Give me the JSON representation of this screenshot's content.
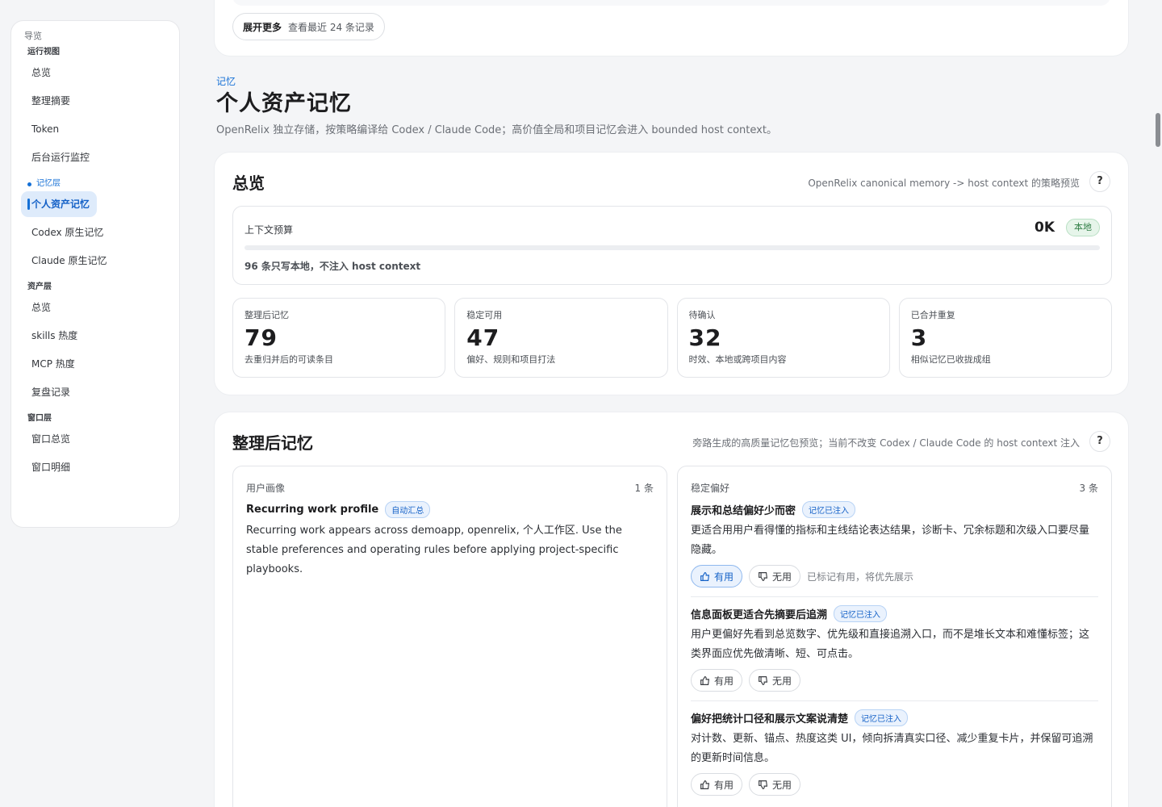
{
  "sidebar": {
    "title": "导览",
    "groups": [
      {
        "label": "运行视图",
        "items": [
          "总览",
          "整理摘要",
          "Token",
          "后台运行监控"
        ]
      },
      {
        "label": "记忆层",
        "items": [
          "个人资产记忆",
          "Codex 原生记忆",
          "Claude 原生记忆"
        ]
      },
      {
        "label": "资产层",
        "items": [
          "总览",
          "skills 热度",
          "MCP 热度",
          "复盘记录"
        ]
      },
      {
        "label": "窗口层",
        "items": [
          "窗口总览",
          "窗口明细"
        ]
      }
    ]
  },
  "top": {
    "expand_bold": "展开更多",
    "expand_sub": "查看最近 24 条记录"
  },
  "section": {
    "tag": "记忆",
    "title": "个人资产记忆",
    "desc": "OpenRelix 独立存储，按策略编译给 Codex / Claude Code；高价值全局和项目记忆会进入 bounded host context。"
  },
  "overview": {
    "title": "总览",
    "hint": "OpenRelix canonical memory -> host context 的策略预览",
    "help": "?",
    "budget": {
      "label": "上下文预算",
      "value": "0K",
      "badge": "本地",
      "fill": 0,
      "note": "96 条只写本地，不注入 host context"
    },
    "stats": [
      {
        "label": "整理后记忆",
        "value": "79",
        "sub": "去重归并后的可读条目"
      },
      {
        "label": "稳定可用",
        "value": "47",
        "sub": "偏好、规则和项目打法"
      },
      {
        "label": "待确认",
        "value": "32",
        "sub": "时效、本地或跨项目内容"
      },
      {
        "label": "已合并重复",
        "value": "3",
        "sub": "相似记忆已收拢成组"
      }
    ]
  },
  "memory": {
    "title": "整理后记忆",
    "hint": "旁路生成的高质量记忆包预览；当前不改变 Codex / Claude Code 的 host context 注入",
    "help": "?",
    "left": {
      "head": "用户画像",
      "count": "1 条",
      "item": {
        "title": "Recurring work profile",
        "badge": "自动汇总",
        "body": "Recurring work appears across demoapp, openrelix, 个人工作区. Use the stable preferences and operating rules before applying project-specific playbooks."
      }
    },
    "right": {
      "head": "稳定偏好",
      "count": "3 条",
      "items": [
        {
          "title": "展示和总结偏好少而密",
          "badge": "记忆已注入",
          "body": "更适合用用户看得懂的指标和主线结论表达结果，诊断卡、冗余标题和次级入口要尽量隐藏。",
          "useful": "有用",
          "useless": "无用",
          "note": "已标记有用，将优先展示"
        },
        {
          "title": "信息面板更适合先摘要后追溯",
          "badge": "记忆已注入",
          "body": "用户更偏好先看到总览数字、优先级和直接追溯入口，而不是堆长文本和难懂标签；这类界面应优先做清晰、短、可点击。",
          "useful": "有用",
          "useless": "无用"
        },
        {
          "title": "偏好把统计口径和展示文案说清楚",
          "badge": "记忆已注入",
          "body": "对计数、更新、锚点、热度这类 UI，倾向拆清真实口径、减少重复卡片，并保留可追溯的更新时间信息。",
          "useful": "有用",
          "useless": "无用"
        }
      ]
    }
  }
}
